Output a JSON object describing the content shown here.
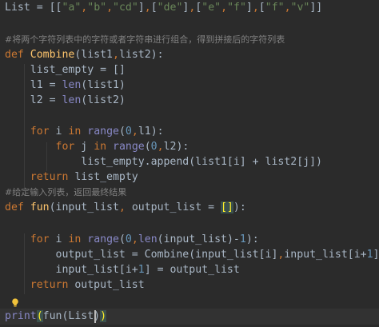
{
  "editor": {
    "colors": {
      "background": "#2b2b2b",
      "current_line": "#323232",
      "keyword": "#cc7832",
      "function": "#ffc66d",
      "builtin": "#8888c6",
      "string": "#6a8759",
      "number": "#6897bb",
      "comment": "#808080",
      "text": "#a9b7c6"
    },
    "lines": [
      {
        "tokens": [
          {
            "t": "List = [[",
            "c": "plain"
          },
          {
            "t": "\"a\"",
            "c": "str"
          },
          {
            "t": ",",
            "c": "punct-hl"
          },
          {
            "t": "\"b\"",
            "c": "str"
          },
          {
            "t": ",",
            "c": "punct-hl"
          },
          {
            "t": "\"cd\"",
            "c": "str"
          },
          {
            "t": "]",
            "c": "plain"
          },
          {
            "t": ",",
            "c": "punct-hl"
          },
          {
            "t": "[",
            "c": "plain"
          },
          {
            "t": "\"de\"",
            "c": "str"
          },
          {
            "t": "]",
            "c": "plain"
          },
          {
            "t": ",",
            "c": "punct-hl"
          },
          {
            "t": "[",
            "c": "plain"
          },
          {
            "t": "\"e\"",
            "c": "str"
          },
          {
            "t": ",",
            "c": "punct-hl"
          },
          {
            "t": "\"f\"",
            "c": "str"
          },
          {
            "t": "]",
            "c": "plain"
          },
          {
            "t": ",",
            "c": "punct-hl"
          },
          {
            "t": "[",
            "c": "plain"
          },
          {
            "t": "\"f\"",
            "c": "str"
          },
          {
            "t": ",",
            "c": "punct-hl"
          },
          {
            "t": "\"v\"",
            "c": "str"
          },
          {
            "t": "]]",
            "c": "plain"
          }
        ]
      },
      {
        "tokens": []
      },
      {
        "tokens": [
          {
            "t": "#将两个字符列表中的字符或者字符串进行组合，得到拼接后的字符列表",
            "c": "comment"
          }
        ]
      },
      {
        "tokens": [
          {
            "t": "def ",
            "c": "kw"
          },
          {
            "t": "Combine",
            "c": "fn"
          },
          {
            "t": "(list1",
            "c": "plain"
          },
          {
            "t": ",",
            "c": "punct-hl"
          },
          {
            "t": "list2):",
            "c": "plain"
          }
        ]
      },
      {
        "tokens": [
          {
            "t": "    list_empty = []",
            "c": "plain"
          }
        ]
      },
      {
        "tokens": [
          {
            "t": "    l1 = ",
            "c": "plain"
          },
          {
            "t": "len",
            "c": "builtin"
          },
          {
            "t": "(list1)",
            "c": "plain"
          }
        ]
      },
      {
        "tokens": [
          {
            "t": "    l2 = ",
            "c": "plain"
          },
          {
            "t": "len",
            "c": "builtin"
          },
          {
            "t": "(list2)",
            "c": "plain"
          }
        ]
      },
      {
        "tokens": []
      },
      {
        "tokens": [
          {
            "t": "    ",
            "c": "plain"
          },
          {
            "t": "for ",
            "c": "kw"
          },
          {
            "t": "i ",
            "c": "plain"
          },
          {
            "t": "in ",
            "c": "kw"
          },
          {
            "t": "range",
            "c": "builtin"
          },
          {
            "t": "(",
            "c": "plain"
          },
          {
            "t": "0",
            "c": "num"
          },
          {
            "t": ",",
            "c": "punct-hl"
          },
          {
            "t": "l1):",
            "c": "plain"
          }
        ]
      },
      {
        "tokens": [
          {
            "t": "        ",
            "c": "plain"
          },
          {
            "t": "for ",
            "c": "kw"
          },
          {
            "t": "j ",
            "c": "plain"
          },
          {
            "t": "in ",
            "c": "kw"
          },
          {
            "t": "range",
            "c": "builtin"
          },
          {
            "t": "(",
            "c": "plain"
          },
          {
            "t": "0",
            "c": "num"
          },
          {
            "t": ",",
            "c": "punct-hl"
          },
          {
            "t": "l2):",
            "c": "plain"
          }
        ]
      },
      {
        "tokens": [
          {
            "t": "            list_empty.append(list1[i] + list2[j])",
            "c": "plain"
          }
        ]
      },
      {
        "tokens": [
          {
            "t": "    ",
            "c": "plain"
          },
          {
            "t": "return ",
            "c": "kw"
          },
          {
            "t": "list_empty",
            "c": "plain"
          }
        ]
      },
      {
        "tokens": [
          {
            "t": "#给定输入列表，返回最终结果",
            "c": "comment"
          }
        ]
      },
      {
        "tokens": [
          {
            "t": "def ",
            "c": "kw"
          },
          {
            "t": "fun",
            "c": "fn"
          },
          {
            "t": "(input_list",
            "c": "plain"
          },
          {
            "t": ", ",
            "c": "punct-hl"
          },
          {
            "t": "output_list = ",
            "c": "plain"
          },
          {
            "t": "[]",
            "c": "bracket-hl"
          },
          {
            "t": "):",
            "c": "plain"
          }
        ]
      },
      {
        "tokens": []
      },
      {
        "tokens": [
          {
            "t": "    ",
            "c": "plain"
          },
          {
            "t": "for ",
            "c": "kw"
          },
          {
            "t": "i ",
            "c": "plain"
          },
          {
            "t": "in ",
            "c": "kw"
          },
          {
            "t": "range",
            "c": "builtin"
          },
          {
            "t": "(",
            "c": "plain"
          },
          {
            "t": "0",
            "c": "num"
          },
          {
            "t": ",",
            "c": "punct-hl"
          },
          {
            "t": "len",
            "c": "builtin"
          },
          {
            "t": "(input_list)-",
            "c": "plain"
          },
          {
            "t": "1",
            "c": "num"
          },
          {
            "t": "):",
            "c": "plain"
          }
        ]
      },
      {
        "tokens": [
          {
            "t": "        output_list = Combine(input_list[i]",
            "c": "plain"
          },
          {
            "t": ",",
            "c": "punct-hl"
          },
          {
            "t": "input_list[i+",
            "c": "plain"
          },
          {
            "t": "1",
            "c": "num"
          },
          {
            "t": "])",
            "c": "plain"
          }
        ]
      },
      {
        "tokens": [
          {
            "t": "        input_list[i+",
            "c": "plain"
          },
          {
            "t": "1",
            "c": "num"
          },
          {
            "t": "] = output_list",
            "c": "plain"
          }
        ]
      },
      {
        "tokens": [
          {
            "t": "    ",
            "c": "plain"
          },
          {
            "t": "return ",
            "c": "kw"
          },
          {
            "t": "output_list",
            "c": "plain"
          }
        ]
      },
      {
        "tokens": []
      },
      {
        "tokens": [
          {
            "t": "print",
            "c": "builtin"
          },
          {
            "t": "(",
            "c": "paren-hl"
          },
          {
            "t": "fun(List)",
            "c": "plain"
          },
          {
            "t": ")",
            "c": "paren-hl"
          }
        ]
      }
    ],
    "current_line_index": 20,
    "gutter_icon": "lightbulb-icon"
  }
}
